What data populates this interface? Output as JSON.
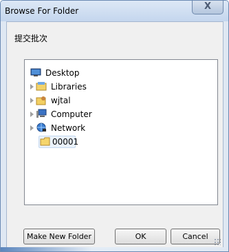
{
  "window": {
    "title": "Browse For Folder",
    "close_glyph": "X"
  },
  "prompt": "提交批次",
  "tree": {
    "items": [
      {
        "label": "Desktop",
        "icon": "desktop-icon",
        "has_expander": false
      },
      {
        "label": "Libraries",
        "icon": "libraries-icon",
        "has_expander": true
      },
      {
        "label": "wjtal",
        "icon": "user-folder-icon",
        "has_expander": true
      },
      {
        "label": "Computer",
        "icon": "computer-icon",
        "has_expander": true
      },
      {
        "label": "Network",
        "icon": "network-icon",
        "has_expander": true
      },
      {
        "label": "00001",
        "icon": "folder-icon",
        "has_expander": false,
        "selected": true
      }
    ]
  },
  "buttons": {
    "make_new_folder": "Make New Folder",
    "ok": "OK",
    "cancel": "Cancel"
  }
}
